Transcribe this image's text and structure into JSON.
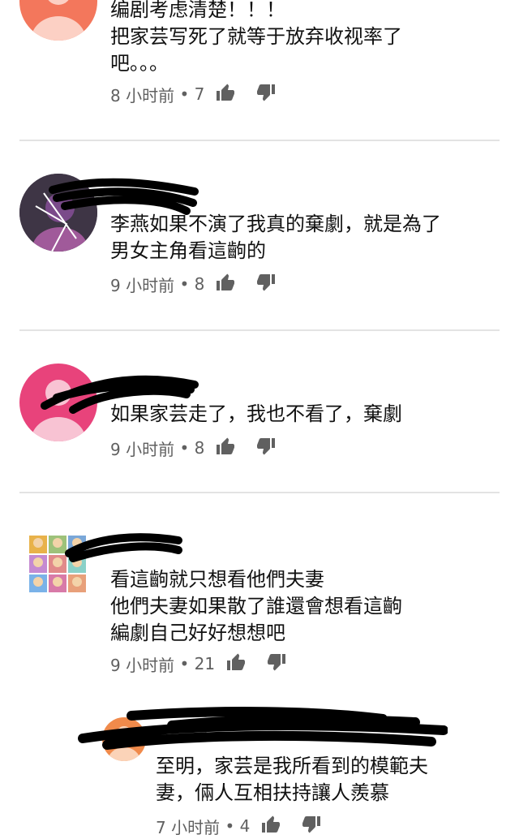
{
  "comments": [
    {
      "text": "编剧考虑清楚！！！\n把家芸写死了就等于放弃收视率了\n吧。。。",
      "time": "8 小时前",
      "likes": "7",
      "avatar_color": "#f3775c"
    },
    {
      "text": "李燕如果不演了我真的棄劇，就是為了\n男女主角看這齣的",
      "time": "9 小时前",
      "likes": "8",
      "avatar_color": "#4c3d55"
    },
    {
      "text": "如果家芸走了，我也不看了，棄劇",
      "time": "9 小时前",
      "likes": "8",
      "avatar_color": "#e8437b"
    },
    {
      "text": "看這齣就只想看他們夫妻\n他們夫妻如果散了誰還會想看這齣\n編劇自己好好想想吧",
      "time": "9 小时前",
      "likes": "21",
      "avatar_color": "#d8a0a0"
    },
    {
      "text": "至明，家芸是我所看到的模範夫\n妻，倆人互相扶持讓人羨慕",
      "time": "7 小时前",
      "likes": "4",
      "avatar_color": "#f08a4b"
    }
  ],
  "icons": {
    "like": "thumb-up-icon",
    "dislike": "thumb-down-icon"
  }
}
